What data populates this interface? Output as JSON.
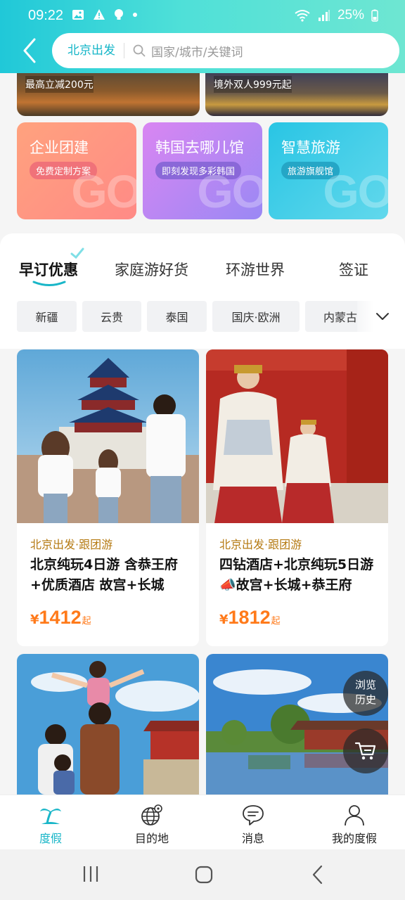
{
  "status_bar": {
    "time": "09:22",
    "battery": "25%"
  },
  "header": {
    "city": "北京出发",
    "search_placeholder": "国家/城市/关键词"
  },
  "banners": [
    {
      "label": "最高立减200元"
    },
    {
      "label": "境外双人999元起"
    }
  ],
  "promos": [
    {
      "title": "企业团建",
      "tag": "免费定制方案",
      "watermark": "GO"
    },
    {
      "title": "韩国去哪儿馆",
      "tag": "即刻发现多彩韩国",
      "watermark": "GO"
    },
    {
      "title": "智慧旅游",
      "tag": "旅游旗舰馆",
      "watermark": "GO"
    }
  ],
  "tabs": [
    {
      "label": "早订优惠",
      "active": true
    },
    {
      "label": "家庭游好货",
      "active": false
    },
    {
      "label": "环游世界",
      "active": false
    },
    {
      "label": "签证",
      "active": false
    }
  ],
  "chips": [
    "新疆",
    "云贵",
    "泰国",
    "国庆·欧洲",
    "内蒙古"
  ],
  "products": [
    {
      "tag": "北京出发·跟团游",
      "title": "北京纯玩4日游 含恭王府+优质酒店 故宫+长城",
      "price_symbol": "¥",
      "price": "1412",
      "price_unit": "起"
    },
    {
      "tag": "北京出发·跟团游",
      "title": "四钻酒店+北京纯玩5日游📣故宫+长城+恭王府",
      "price_symbol": "¥",
      "price": "1812",
      "price_unit": "起"
    },
    {
      "tag": "",
      "title": "",
      "price": ""
    },
    {
      "tag": "",
      "title": "",
      "price": ""
    }
  ],
  "floating": {
    "history_line1": "浏览",
    "history_line2": "历史"
  },
  "bottom_nav": [
    {
      "label": "度假",
      "icon": "palm-tree-icon",
      "active": true
    },
    {
      "label": "目的地",
      "icon": "globe-icon",
      "active": false
    },
    {
      "label": "消息",
      "icon": "chat-icon",
      "active": false
    },
    {
      "label": "我的度假",
      "icon": "user-icon",
      "active": false
    }
  ],
  "colors": {
    "accent": "#19b6c8",
    "price": "#ff7a1a",
    "tag": "#b57a12"
  }
}
